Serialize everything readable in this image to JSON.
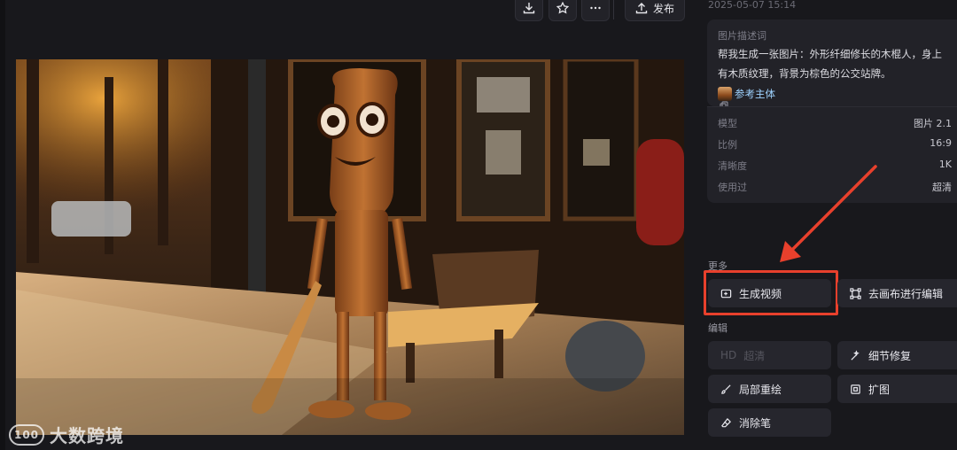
{
  "toolbar": {
    "download_icon": "download-icon",
    "star_icon": "star-icon",
    "more_icon": "more-horizontal-icon",
    "publish_icon": "upload-icon",
    "publish_label": "发布"
  },
  "panel": {
    "timestamp": "2025-05-07 15:14",
    "description_title": "图片描述词",
    "description_text": "帮我生成一张图片：外形纤细修长的木棍人，身上有木质纹理，背景为棕色的公交站牌。",
    "reference_label": "参考主体",
    "copy_icon": "copy-icon",
    "params": [
      {
        "key": "模型",
        "value": "图片 2.1"
      },
      {
        "key": "比例",
        "value": "16:9"
      },
      {
        "key": "清晰度",
        "value": "1K"
      },
      {
        "key": "使用过",
        "value": "超清"
      }
    ],
    "more_label": "更多",
    "more_actions": {
      "generate_video": "生成视频",
      "canvas_edit": "去画布进行编辑"
    },
    "edit_label": "编辑",
    "edit_actions": {
      "hd_prefix": "HD",
      "hd_label": "超清",
      "detail_fix": "细节修复",
      "partial_redraw": "局部重绘",
      "expand": "扩图",
      "eraser": "消除笔"
    }
  },
  "watermark": {
    "logo_text": "100",
    "text": "大数跨境"
  },
  "colors": {
    "background": "#18181c",
    "card": "#222228",
    "button": "#26262d",
    "highlight": "#e8402c",
    "link": "#9fd3ff"
  }
}
